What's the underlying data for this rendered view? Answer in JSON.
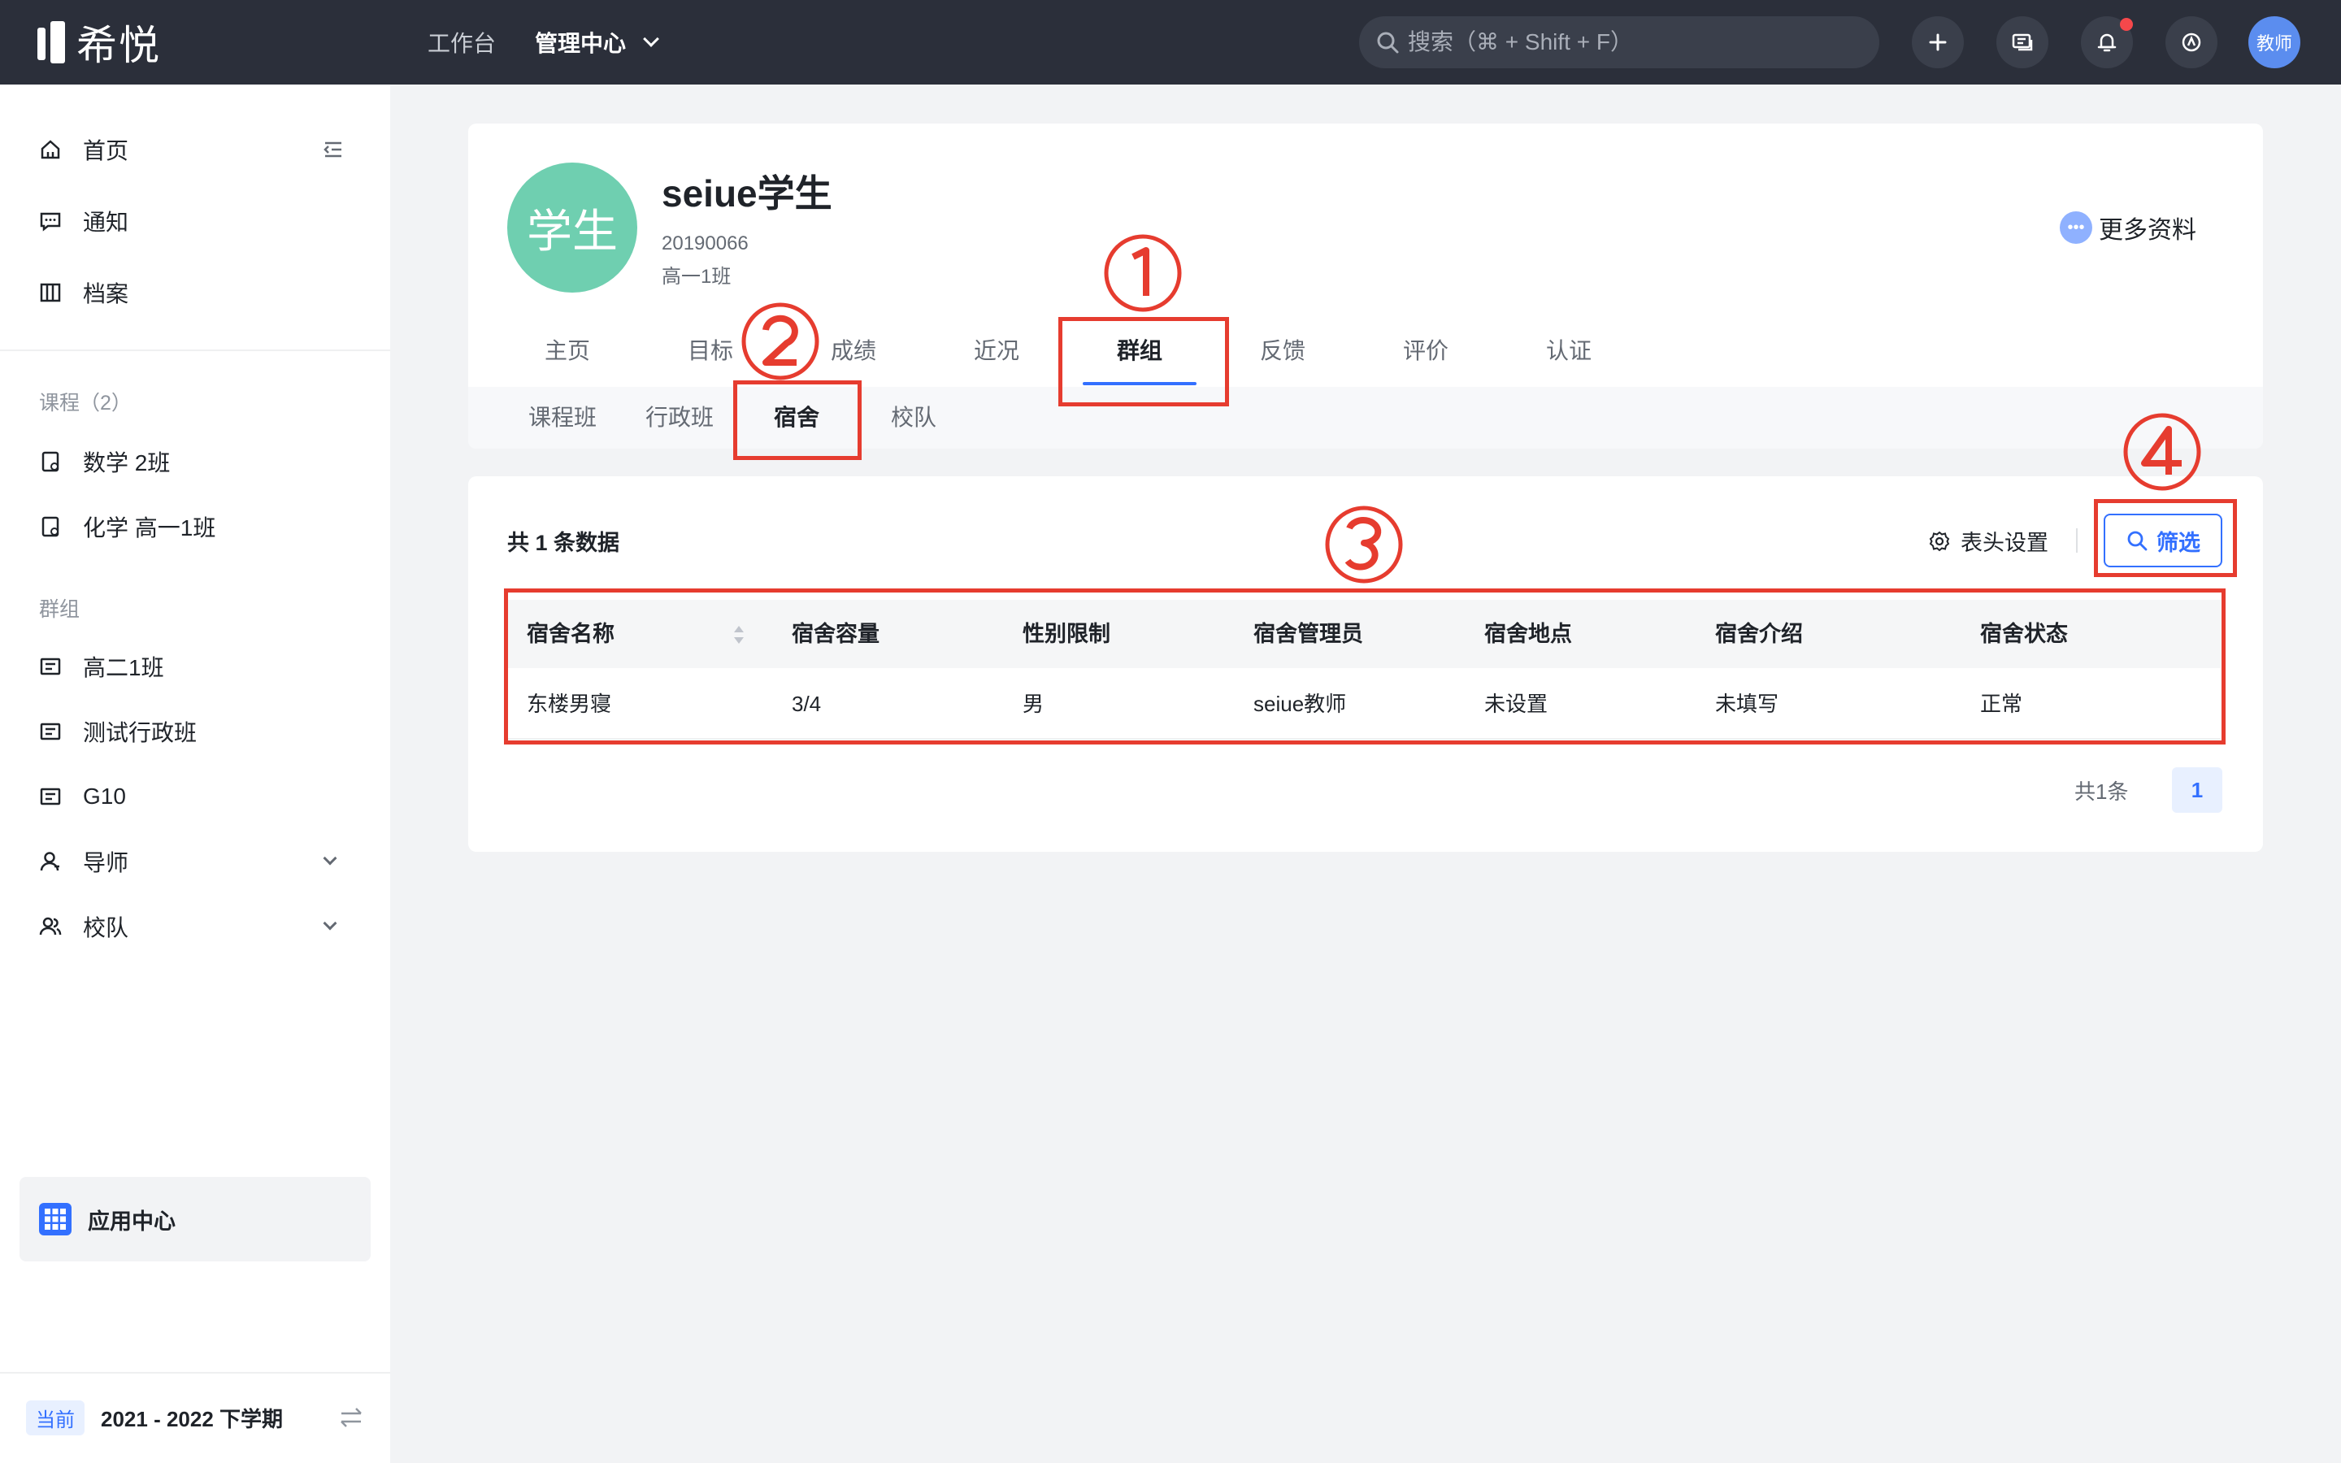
{
  "topbar": {
    "logo_text": "希悦",
    "nav": [
      {
        "label": "工作台"
      },
      {
        "label": "管理中心"
      }
    ],
    "search_placeholder": "搜索（⌘ + Shift + F）",
    "user_label": "教师"
  },
  "sidebar": {
    "main_items": [
      {
        "label": "首页"
      },
      {
        "label": "通知"
      },
      {
        "label": "档案"
      }
    ],
    "courses_title": "课程（2）",
    "courses": [
      {
        "label": "数学 2班"
      },
      {
        "label": "化学 高一1班"
      }
    ],
    "groups_title": "群组",
    "groups": [
      {
        "label": "高二1班"
      },
      {
        "label": "测试行政班"
      },
      {
        "label": "G10"
      },
      {
        "label": "导师"
      },
      {
        "label": "校队"
      }
    ],
    "app_center": "应用中心",
    "term_badge": "当前",
    "term_label": "2021 - 2022 下学期"
  },
  "profile": {
    "avatar_text": "学生",
    "name": "seiue学生",
    "id": "20190066",
    "class_name": "高一1班",
    "more_label": "更多资料",
    "tabs": [
      {
        "label": "主页"
      },
      {
        "label": "目标"
      },
      {
        "label": "成绩"
      },
      {
        "label": "近况"
      },
      {
        "label": "群组"
      },
      {
        "label": "反馈"
      },
      {
        "label": "评价"
      },
      {
        "label": "认证"
      }
    ],
    "active_tab": "群组",
    "subtabs": [
      {
        "label": "课程班"
      },
      {
        "label": "行政班"
      },
      {
        "label": "宿舍"
      },
      {
        "label": "校队"
      }
    ],
    "active_subtab": "宿舍"
  },
  "table": {
    "total_label": "共 1 条数据",
    "column_settings": "表头设置",
    "filter_label": "筛选",
    "headers": [
      "宿舍名称",
      "宿舍容量",
      "性别限制",
      "宿舍管理员",
      "宿舍地点",
      "宿舍介绍",
      "宿舍状态"
    ],
    "rows": [
      [
        "东楼男寝",
        "3/4",
        "男",
        "seiue教师",
        "未设置",
        "未填写",
        "正常"
      ]
    ],
    "pagination_total": "共1条",
    "current_page": "1"
  },
  "annotations": [
    "①",
    "②",
    "③",
    "④"
  ],
  "colors": {
    "topbar": "#2b2f3a",
    "accent": "#3370ff",
    "avatar": "#6fcfb0",
    "annotation": "#e63c2f"
  }
}
